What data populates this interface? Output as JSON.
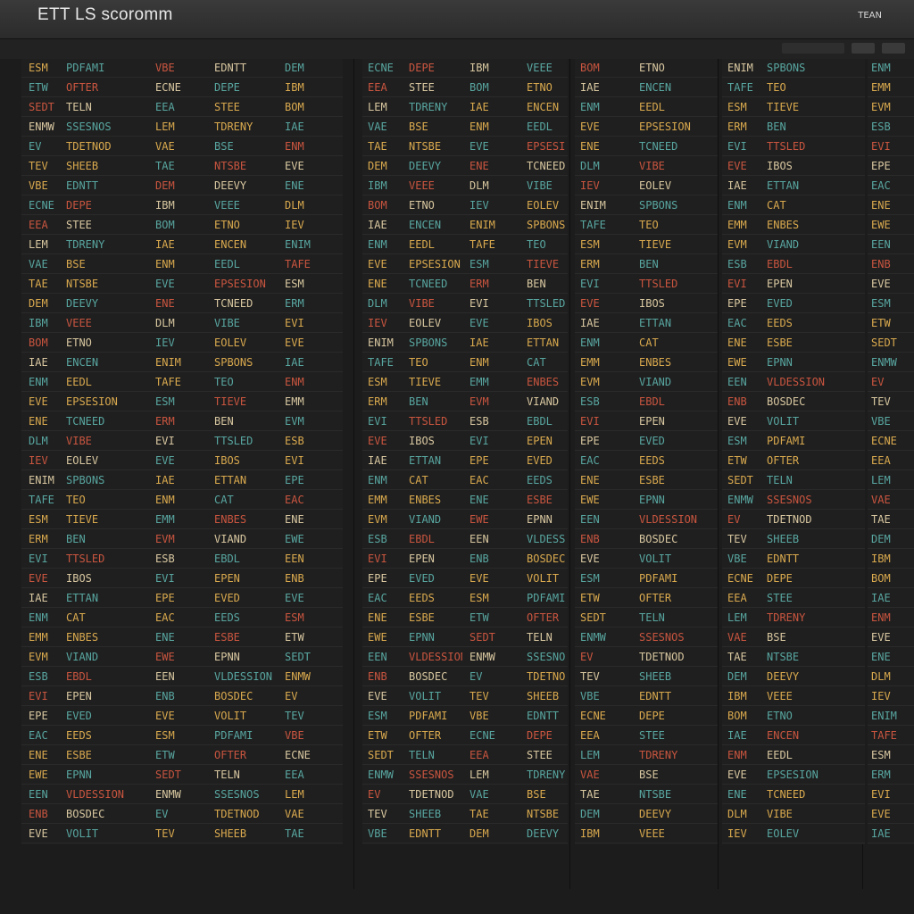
{
  "window": {
    "title": "ETT  LS scoromm",
    "right_label": "TEAN"
  },
  "icons": {
    "mini_controls": "window-controls"
  },
  "colors": {
    "background": "#1c1c1c",
    "amber": "#d9a94e",
    "teal": "#58a6a0",
    "red": "#c9553f",
    "cream": "#d8c7a0"
  },
  "panels": [
    {
      "name": "panel-1",
      "columns": [
        [
          "ESM",
          "ETW",
          "SEDT",
          "ENMW",
          "EV",
          "TEV",
          "VBE",
          "ECNE",
          "EEA",
          "LEM",
          "VAE",
          "TAE",
          "DEM",
          "IBM",
          "BOM",
          "IAE",
          "ENM",
          "EVE",
          "ENE",
          "DLM",
          "IEV",
          "ENIM",
          "TAFE",
          "ESM",
          "ERM",
          "EVI",
          "EVE",
          "IAE",
          "ENM",
          "EMM",
          "EVM",
          "ESB",
          "EVI",
          "EPE",
          "EAC",
          "ENE",
          "EWE",
          "EEN",
          "ENB",
          "EVE"
        ],
        [
          "VLDESSION",
          "BOSDEC",
          "VOLIT",
          "PDFAMI",
          "OFTER",
          "TELN",
          "SSESNOS",
          "TDETNOD",
          "SHEEB",
          "EDNTT",
          "DEPE",
          "STEE",
          "TDRENY",
          "BSE",
          "NTSBE",
          "DEEVY",
          "VEEE",
          "ETNO",
          "ENCEN",
          "EEDL",
          "EPSESION",
          "TCNEED",
          "VIBE",
          "EOLEV",
          "SPBONS",
          "TEO",
          "TIEVE",
          "BEN",
          "TTSLED",
          "IBOS",
          "ETTAN",
          "CAT",
          "ENBES",
          "VIAND",
          "EBDL",
          "EPEN",
          "EVED",
          "EEDS",
          "ESBE",
          "EPNN"
        ]
      ],
      "x": 0,
      "w": 140
    }
  ]
}
